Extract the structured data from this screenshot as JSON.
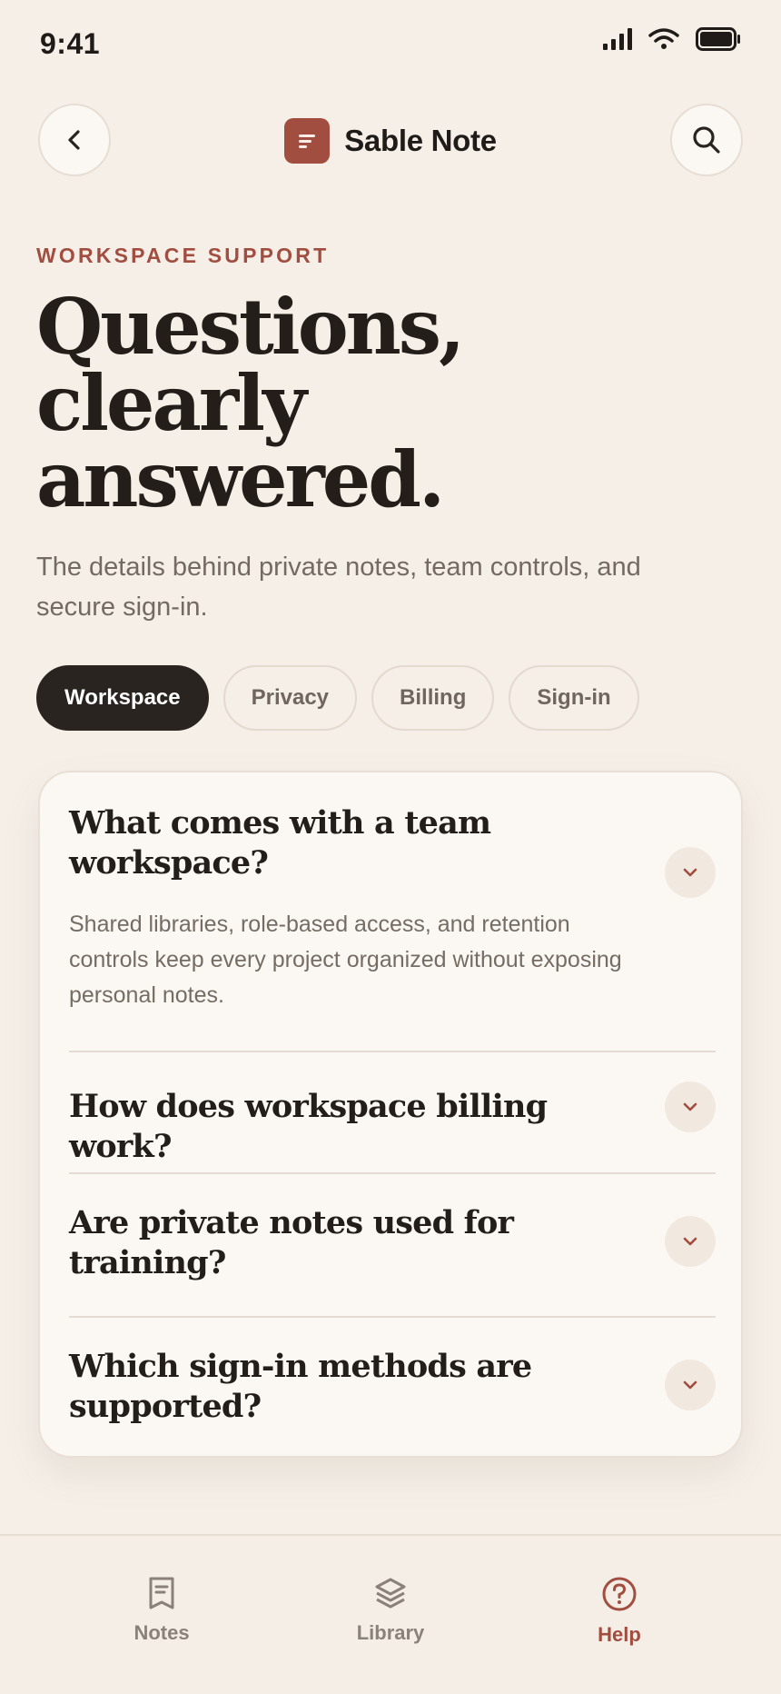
{
  "status": {
    "time": "9:41"
  },
  "header": {
    "brand_name": "Sable Note"
  },
  "hero": {
    "eyebrow": "WORKSPACE SUPPORT",
    "title_lines": [
      "Questions,",
      "clearly",
      "answered."
    ],
    "subtitle": "The details behind private notes, team controls, and secure sign-in."
  },
  "chips": [
    {
      "label": "Workspace",
      "active": true
    },
    {
      "label": "Privacy",
      "active": false
    },
    {
      "label": "Billing",
      "active": false
    },
    {
      "label": "Sign-in",
      "active": false
    }
  ],
  "faq": [
    {
      "question": "What comes with a team workspace?",
      "answer": "Shared libraries, role-based access, and retention controls keep every project organized without exposing personal notes.",
      "expanded": true
    },
    {
      "question": "How does workspace billing work?",
      "expanded": false
    },
    {
      "question": "Are private notes used for training?",
      "expanded": false
    },
    {
      "question": "Which sign-in methods are supported?",
      "expanded": false
    }
  ],
  "tabs": [
    {
      "label": "Notes",
      "icon": "note-icon",
      "active": false
    },
    {
      "label": "Library",
      "icon": "layers-icon",
      "active": false
    },
    {
      "label": "Help",
      "icon": "help-circle-icon",
      "active": true
    }
  ],
  "colors": {
    "accent": "#a14d3f",
    "ink": "#2a2420",
    "background": "#f5efe8"
  }
}
